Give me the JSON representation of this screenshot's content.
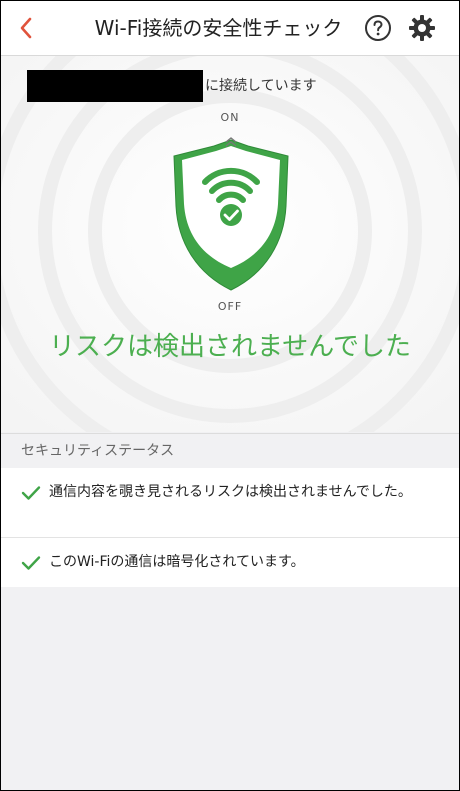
{
  "header": {
    "title": "Wi-Fi接続の安全性チェック",
    "back_icon": "chevron-left-icon",
    "help_icon": "question-circle-icon",
    "settings_icon": "gear-icon",
    "accent": "#e0533c"
  },
  "connection": {
    "status_text": "に接続しています"
  },
  "protection": {
    "on_label": "ON",
    "off_label": "OFF",
    "shield_icon": "wifi-shield-icon",
    "shield_color": "#3fa447"
  },
  "result": {
    "message": "リスクは検出されませんでした",
    "color": "#4caf50"
  },
  "security_status": {
    "section_title": "セキュリティステータス",
    "items": [
      {
        "text": "通信内容を覗き見されるリスクは検出されませんでした。",
        "icon": "check-icon"
      },
      {
        "text": "このWi-Fiの通信は暗号化されています。",
        "icon": "check-icon"
      }
    ]
  }
}
